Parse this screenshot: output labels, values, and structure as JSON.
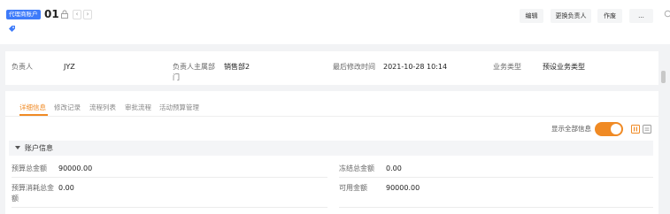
{
  "header": {
    "badge": "代理商账户",
    "record_title": "01",
    "nav_prev": "‹",
    "nav_next": "›",
    "buttons": {
      "edit": "编辑",
      "change_owner": "更换负责人",
      "void": "作废",
      "more": "..."
    }
  },
  "summary": {
    "fields": [
      {
        "label": "负责人",
        "value": "JYZ"
      },
      {
        "label_line1": "负责人主属部",
        "label_line2": "门",
        "value": "销售部2"
      },
      {
        "label": "最后修改时间",
        "value": "2021-10-28 10:14"
      },
      {
        "label": "业务类型",
        "value": "预设业务类型"
      }
    ]
  },
  "tabs": [
    {
      "label": "详细信息",
      "active": true
    },
    {
      "label": "修改记录",
      "active": false
    },
    {
      "label": "流程列表",
      "active": false
    },
    {
      "label": "审批流程",
      "active": false
    },
    {
      "label": "活动预算管理",
      "active": false
    }
  ],
  "show_all": {
    "label": "显示全部信息",
    "on": true
  },
  "section": {
    "title": "账户信息",
    "fields": {
      "budget_total": {
        "label": "预算总金额",
        "value": "90000.00"
      },
      "frozen_total": {
        "label": "冻结总金额",
        "value": "0.00"
      },
      "consumed_total": {
        "label_line1": "预算消耗总金",
        "label_line2": "额",
        "value": "0.00"
      },
      "available": {
        "label": "可用金额",
        "value": "90000.00"
      }
    }
  },
  "colors": {
    "accent_orange": "#f08a24",
    "badge_blue": "#3e7bfa"
  },
  "icons": [
    "lock-icon",
    "tag-icon",
    "search-icon",
    "caret-down-icon",
    "column-view-icon",
    "list-view-icon"
  ]
}
